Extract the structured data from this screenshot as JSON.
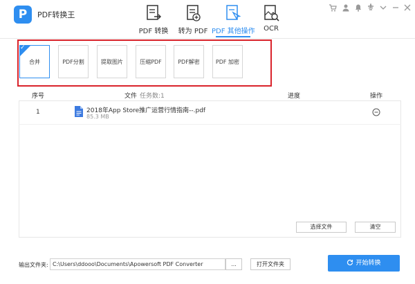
{
  "app": {
    "title": "PDF转换王",
    "logo_letter": "P"
  },
  "nav": {
    "tabs": [
      {
        "label": "PDF 转换"
      },
      {
        "label": "转为 PDF"
      },
      {
        "label": "PDF 其他操作"
      },
      {
        "label": "OCR"
      }
    ],
    "active_index": 2
  },
  "window_controls": [
    "cart-icon",
    "user-icon",
    "bell-icon",
    "settings-icon",
    "dropdown-icon",
    "minimize-icon",
    "close-icon"
  ],
  "tools": {
    "items": [
      {
        "label": "合并"
      },
      {
        "label": "PDF分割"
      },
      {
        "label": "提取图片"
      },
      {
        "label": "压缩PDF"
      },
      {
        "label": "PDF解密"
      },
      {
        "label": "PDF 加密"
      }
    ],
    "active_index": 0
  },
  "table": {
    "col_index": "序号",
    "col_file": "文件",
    "task_count": "任务数:1",
    "col_progress": "进度",
    "col_action": "操作",
    "rows": [
      {
        "index": "1",
        "name": "2018年App Store推广运营行情指南--.pdf",
        "size": "85.3 MB"
      }
    ]
  },
  "actions": {
    "select_file": "选择文件",
    "clear": "清空"
  },
  "output": {
    "label": "输出文件夹:",
    "path": "C:\\Users\\ddooo\\Documents\\Apowersoft PDF Converter",
    "browse": "...",
    "open_folder": "打开文件夹",
    "start": "开始转换"
  },
  "colors": {
    "accent": "#2e8ef0",
    "highlight_frame": "#d9222a"
  }
}
